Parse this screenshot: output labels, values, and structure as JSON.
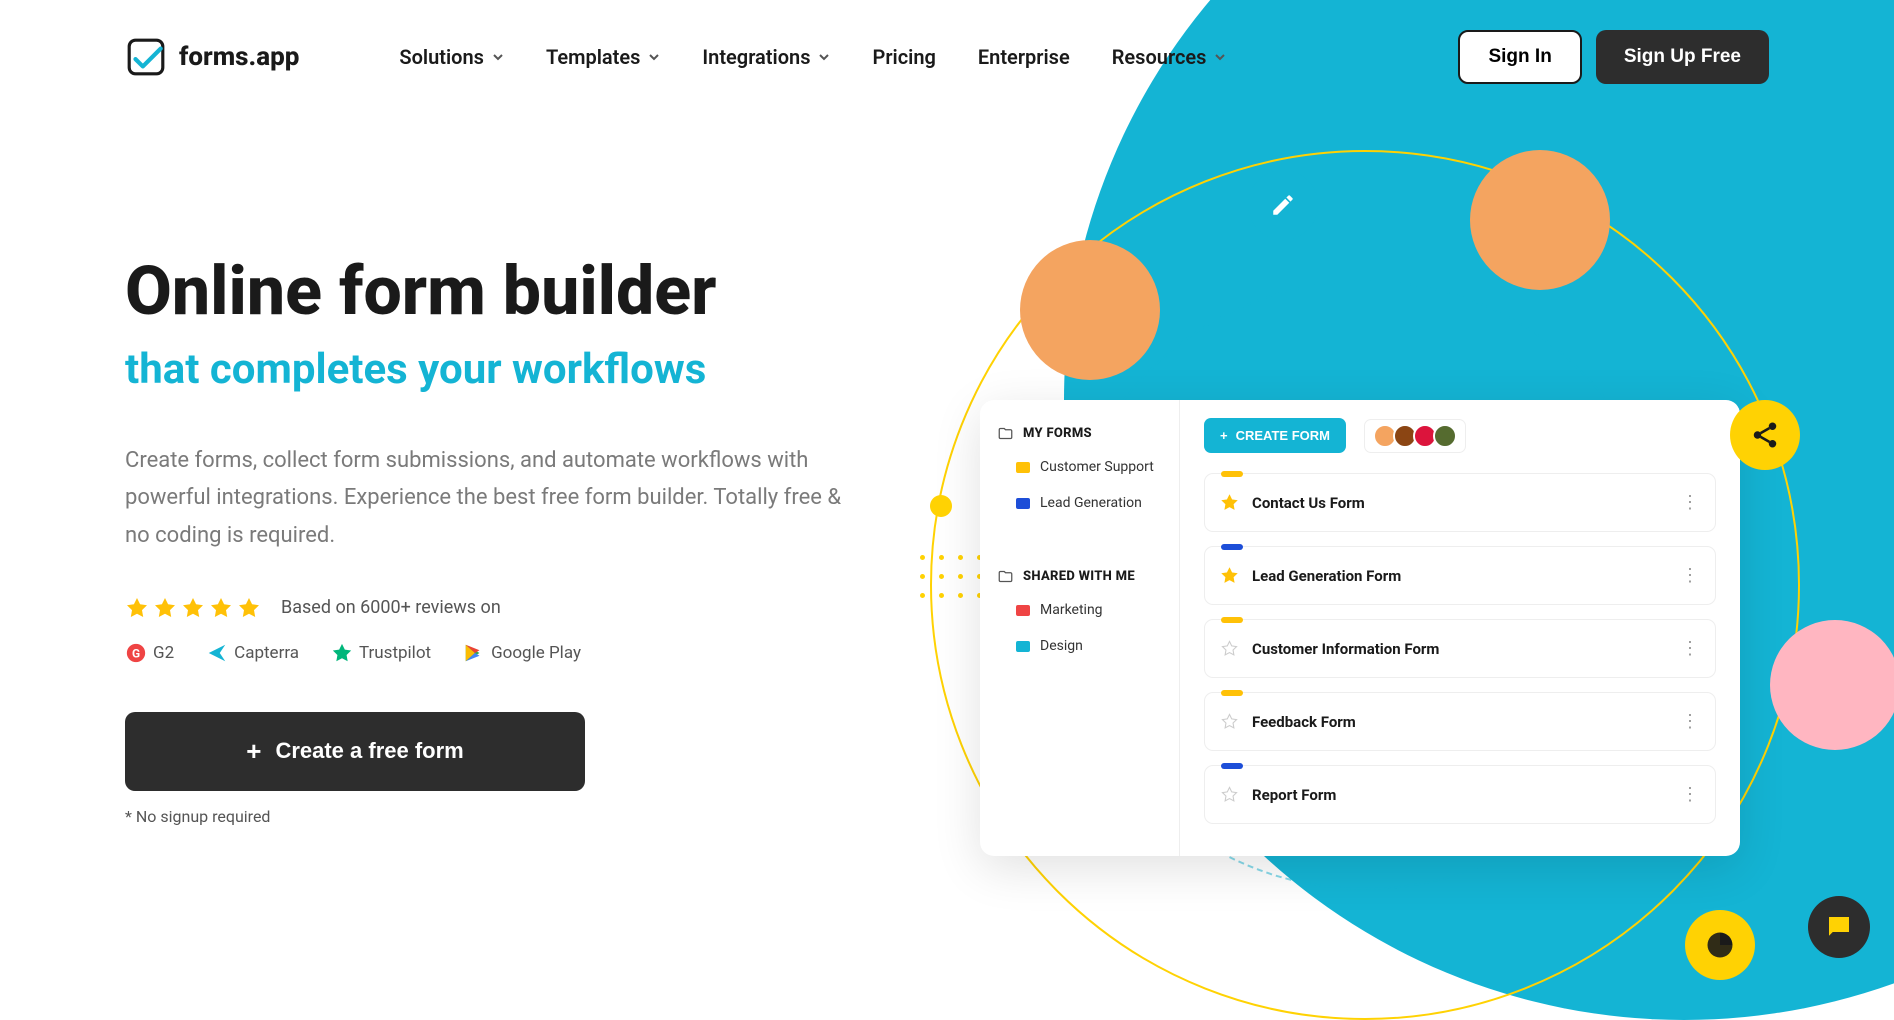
{
  "header": {
    "logo_text": "forms.app",
    "nav": [
      "Solutions",
      "Templates",
      "Integrations",
      "Pricing",
      "Enterprise",
      "Resources"
    ],
    "nav_has_dropdown": [
      true,
      true,
      true,
      false,
      false,
      true
    ],
    "signin": "Sign In",
    "signup": "Sign Up Free"
  },
  "hero": {
    "title": "Online form builder",
    "subtitle": "that completes your workflows",
    "description": "Create forms, collect form submissions, and automate workflows with powerful integrations. Experience the best free form builder. Totally free & no coding is required.",
    "rating_text": "Based on 6000+ reviews on",
    "platforms": [
      "G2",
      "Capterra",
      "Trustpilot",
      "Google Play"
    ],
    "cta": "Create a free form",
    "cta_note": "* No signup required"
  },
  "dashboard": {
    "my_forms_label": "MY FORMS",
    "shared_label": "SHARED WITH ME",
    "my_folders": [
      {
        "name": "Customer Support",
        "color": "#ffc107"
      },
      {
        "name": "Lead Generation",
        "color": "#1d4ed8"
      }
    ],
    "shared_folders": [
      {
        "name": "Marketing",
        "color": "#ef4444"
      },
      {
        "name": "Design",
        "color": "#14b4d4"
      }
    ],
    "create_form": "CREATE FORM",
    "forms": [
      {
        "name": "Contact Us Form",
        "starred": true,
        "accent": "#ffc107"
      },
      {
        "name": "Lead Generation Form",
        "starred": true,
        "accent": "#1d4ed8"
      },
      {
        "name": "Customer Information Form",
        "starred": false,
        "accent": "#ffc107"
      },
      {
        "name": "Feedback Form",
        "starred": false,
        "accent": "#ffc107"
      },
      {
        "name": "Report Form",
        "starred": false,
        "accent": "#1d4ed8"
      }
    ],
    "avatar_colors": [
      "#f4a460",
      "#8b4513",
      "#dc143c",
      "#556b2f"
    ]
  }
}
